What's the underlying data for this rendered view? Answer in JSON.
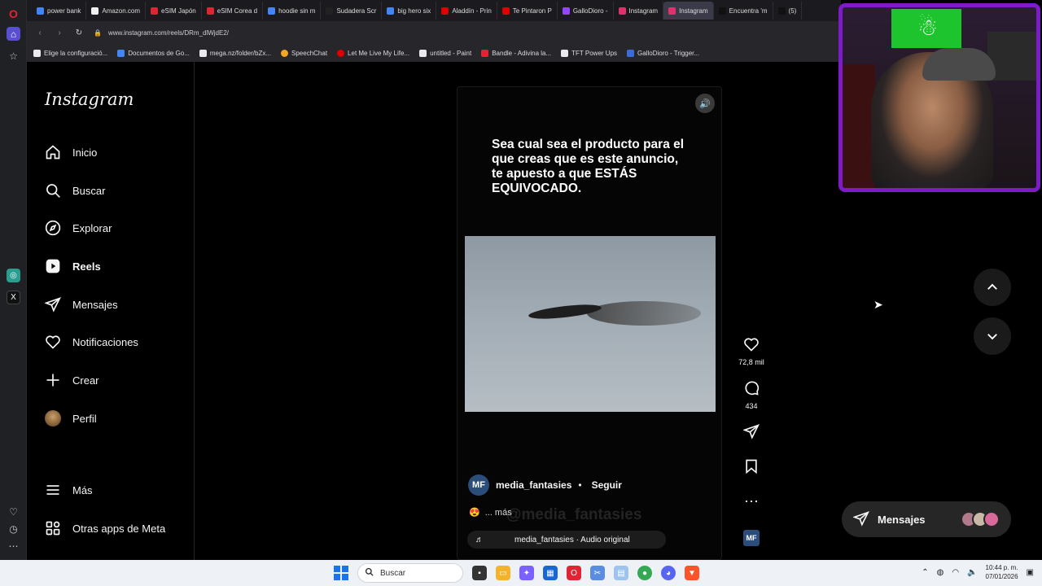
{
  "browser": {
    "tabs": [
      {
        "label": "power bank",
        "color": "#4285f4",
        "active": false
      },
      {
        "label": "Amazon.com",
        "color": "#f0f0f0",
        "active": false
      },
      {
        "label": "eSIM Japón",
        "color": "#e02433",
        "active": false
      },
      {
        "label": "eSIM Corea d",
        "color": "#e02433",
        "active": false
      },
      {
        "label": "hoodie sin m",
        "color": "#4285f4",
        "active": false
      },
      {
        "label": "Sudadera Scr",
        "color": "#222222",
        "active": false
      },
      {
        "label": "big hero six",
        "color": "#4285f4",
        "active": false
      },
      {
        "label": "Aladdín - Prin",
        "color": "#e00000",
        "active": false
      },
      {
        "label": "Te Pintaron P",
        "color": "#e00000",
        "active": false
      },
      {
        "label": "GalloDioro -",
        "color": "#9146ff",
        "active": false
      },
      {
        "label": "Instagram",
        "color": "#e1306c",
        "active": false
      },
      {
        "label": "Instagram",
        "color": "#e1306c",
        "active": true
      },
      {
        "label": "Encuentra 'm",
        "color": "#111111",
        "active": false
      },
      {
        "label": "(5)",
        "color": "#111111",
        "active": false
      }
    ],
    "url": "www.instagram.com/reels/DRm_dlWjdE2/",
    "bookmarks": [
      {
        "label": "Elige la configuració...",
        "color": "#e8eaed"
      },
      {
        "label": "Documentos de Go...",
        "color": "#4285f4"
      },
      {
        "label": "mega.nz/folder/bZx...",
        "color": "#e8eaed"
      },
      {
        "label": "SpeechChat",
        "color": "#f5a623"
      },
      {
        "label": "Let Me Live My Life...",
        "color": "#e00000"
      },
      {
        "label": "untitled - Paint",
        "color": "#e8eaed"
      },
      {
        "label": "Bandle - Adivina la...",
        "color": "#e02433"
      },
      {
        "label": "TFT Power Ups",
        "color": "#e8eaed"
      },
      {
        "label": "GalloDioro - Trigger...",
        "color": "#3b6bd6"
      }
    ]
  },
  "instagram": {
    "logo": "Instagram",
    "nav": [
      {
        "label": "Inicio",
        "icon": "home-icon"
      },
      {
        "label": "Buscar",
        "icon": "search-icon"
      },
      {
        "label": "Explorar",
        "icon": "compass-icon"
      },
      {
        "label": "Reels",
        "icon": "reels-icon"
      },
      {
        "label": "Mensajes",
        "icon": "messages-icon"
      },
      {
        "label": "Notificaciones",
        "icon": "heart-icon"
      },
      {
        "label": "Crear",
        "icon": "plus-icon"
      },
      {
        "label": "Perfil",
        "icon": "avatar"
      }
    ],
    "more": "Más",
    "meta_apps": "Otras apps de Meta",
    "reel": {
      "overlay_text": "Sea cual sea el producto para el que creas que es este anuncio, te apuesto a que ESTÁS EQUIVOCADO.",
      "author_initials": "MF",
      "author": "media_fantasies",
      "dot": "•",
      "follow": "Seguir",
      "caption_more": "... más",
      "watermark": "@media_fantasies",
      "audio": "media_fantasies · Audio original"
    },
    "actions": {
      "likes": "72,8 mil",
      "comments": "434",
      "audio_initials": "MF"
    },
    "messages_pill": "Mensajes"
  },
  "taskbar": {
    "search_placeholder": "Buscar",
    "time": "10:44 p. m.",
    "date": "07/01/2026"
  }
}
